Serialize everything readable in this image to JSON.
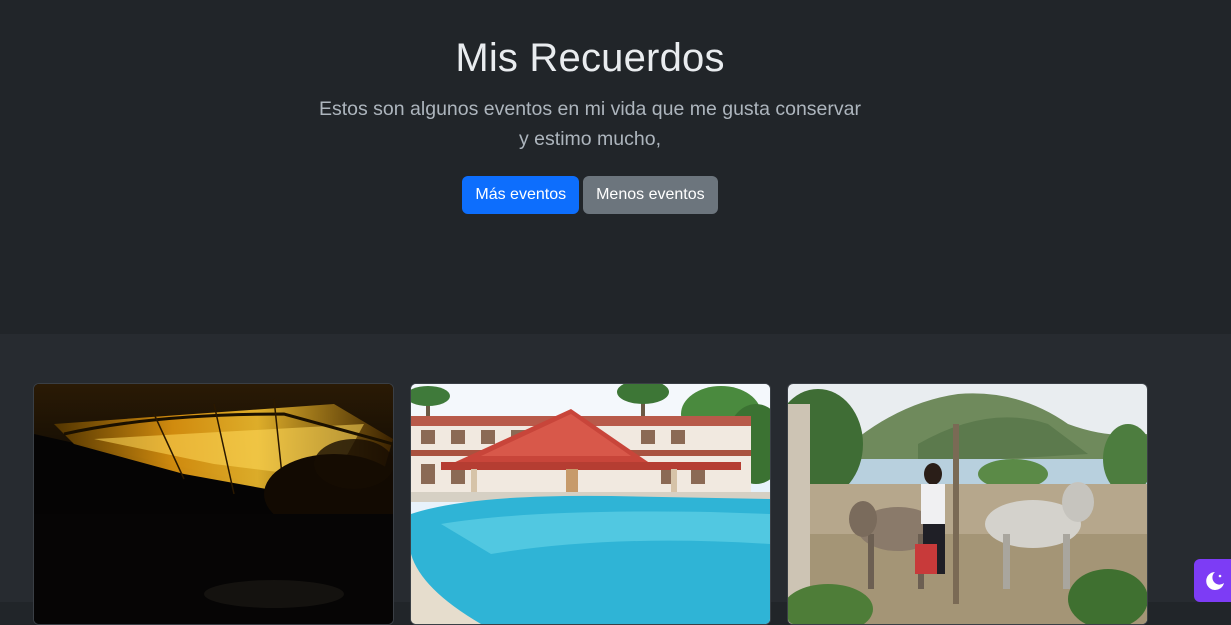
{
  "hero": {
    "title": "Mis Recuerdos",
    "lead": "Estos son algunos eventos en mi vida que me gusta conservar y estimo mucho,",
    "primary_button": "Más eventos",
    "secondary_button": "Menos eventos"
  },
  "colors": {
    "hero_bg": "#212529",
    "album_bg": "#272b30",
    "primary": "#0d6efd",
    "secondary": "#6c757d",
    "theme_toggle": "#7d3cf5"
  },
  "cards": [
    {
      "image": "sunset-photo"
    },
    {
      "image": "pool-resort-photo"
    },
    {
      "image": "cattle-lake-photo"
    }
  ],
  "theme_toggle": {
    "icon": "moon-stars-icon"
  }
}
